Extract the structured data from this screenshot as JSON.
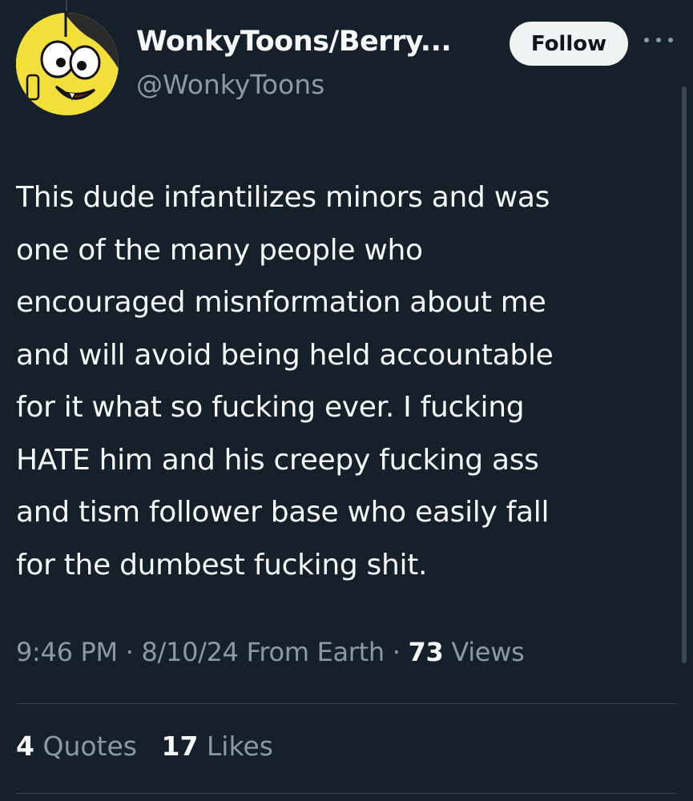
{
  "tweet": {
    "author": {
      "display_name": "WonkyToons/Berry...",
      "handle": "@WonkyToons",
      "avatar_icon": "cartoon-face-avatar"
    },
    "follow_label": "Follow",
    "more_icon": "more-horizontal-icon",
    "text": "This dude infantilizes minors and was\none of the many people who\nencouraged misnformation about me\nand will avoid being held accountable\nfor it what so fucking ever. I fucking\nHATE him and his creepy fucking ass\nand tism follower base who easily fall\nfor the dumbest fucking shit.",
    "meta": {
      "time": "9:46 PM",
      "separator": "·",
      "date": "8/10/24",
      "location": "From Earth",
      "views_count": "73",
      "views_label": "Views"
    },
    "stats": {
      "quotes_count": "4",
      "quotes_label": "Quotes",
      "likes_count": "17",
      "likes_label": "Likes"
    }
  },
  "colors": {
    "background": "#15202b",
    "text_primary": "#f7f9f9",
    "text_secondary": "#8b98a5",
    "divider": "#38444d",
    "follow_bg": "#eff3f4",
    "avatar_bg": "#f2df3a"
  }
}
